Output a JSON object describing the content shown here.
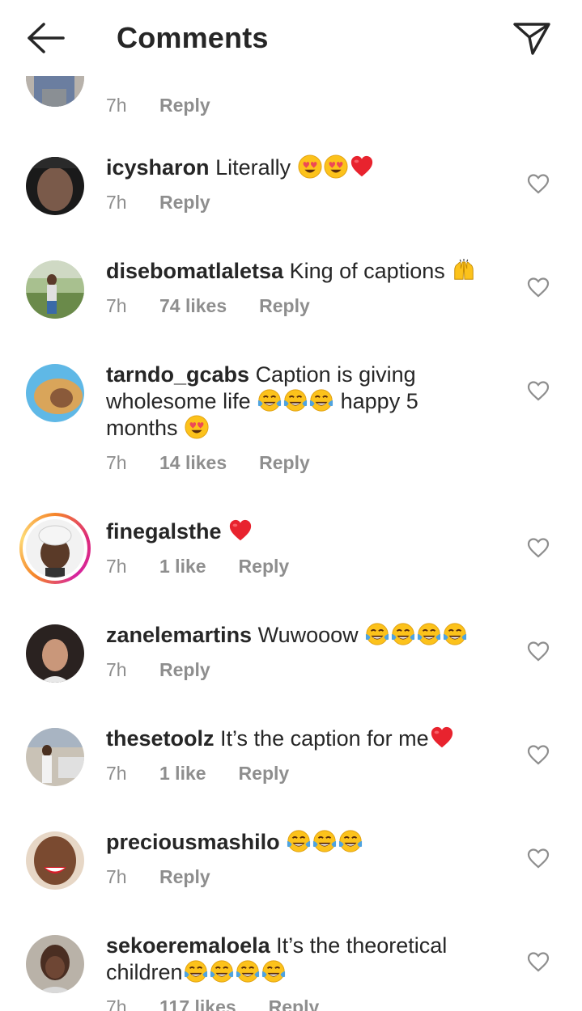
{
  "header": {
    "title": "Comments",
    "back_icon": "arrow-left-icon",
    "send_icon": "paper-plane-icon"
  },
  "comments": [
    {
      "username": "",
      "text": "",
      "time": "7h",
      "likes": "",
      "reply": "Reply"
    },
    {
      "username": "icysharon",
      "text": "Literally",
      "time": "7h",
      "likes": "",
      "reply": "Reply"
    },
    {
      "username": "disebomatlaletsa",
      "text": "King of captions",
      "time": "7h",
      "likes": "74 likes",
      "reply": "Reply"
    },
    {
      "username": "tarndo_gcabs",
      "text": "Caption is giving wholesome life",
      "text2": "happy 5 months",
      "time": "7h",
      "likes": "14 likes",
      "reply": "Reply"
    },
    {
      "username": "finegalsthe",
      "text": "",
      "time": "7h",
      "likes": "1 like",
      "reply": "Reply"
    },
    {
      "username": "zanelemartins",
      "text": "Wuwooow",
      "time": "7h",
      "likes": "",
      "reply": "Reply"
    },
    {
      "username": "thesetoolz",
      "text": "It’s the caption for me",
      "time": "7h",
      "likes": "1 like",
      "reply": "Reply"
    },
    {
      "username": "preciousmashilo",
      "text": "",
      "time": "7h",
      "likes": "",
      "reply": "Reply"
    },
    {
      "username": "sekoeremaloela",
      "text": "It’s the theoretical children",
      "time": "7h",
      "likes": "117 likes",
      "reply": "Reply"
    }
  ],
  "colors": {
    "text": "#262626",
    "secondary": "#8e8e8e",
    "heart_red": "#ed4956"
  }
}
